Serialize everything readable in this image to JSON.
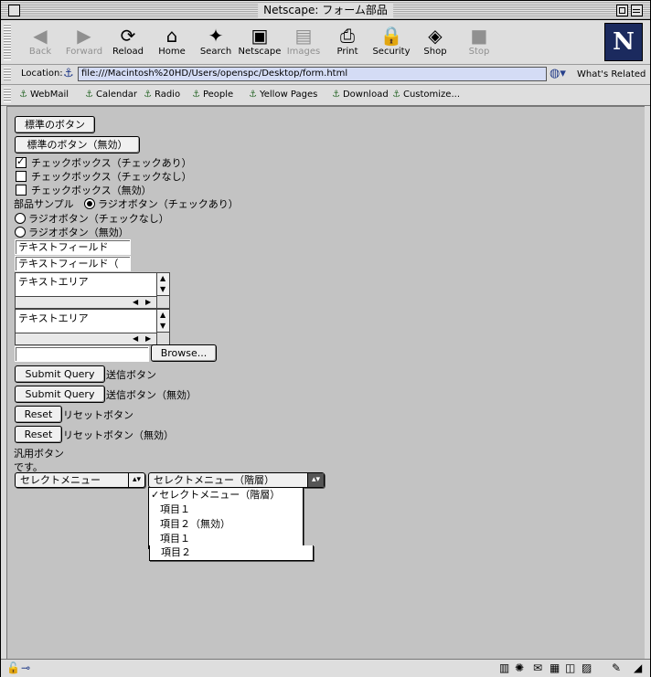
{
  "window": {
    "title": "Netscape: フォーム部品"
  },
  "toolbar": {
    "buttons": [
      {
        "label": "Back",
        "icon": "left-arrow-icon",
        "glyph": "◀",
        "enabled": false
      },
      {
        "label": "Forward",
        "icon": "right-arrow-icon",
        "glyph": "▶",
        "enabled": false
      },
      {
        "label": "Reload",
        "icon": "reload-icon",
        "glyph": "⟳",
        "enabled": true
      },
      {
        "label": "Home",
        "icon": "home-icon",
        "glyph": "⌂",
        "enabled": true
      },
      {
        "label": "Search",
        "icon": "search-icon",
        "glyph": "✦",
        "enabled": true
      },
      {
        "label": "Netscape",
        "icon": "my-netscape-icon",
        "glyph": "▣",
        "enabled": true
      },
      {
        "label": "Images",
        "icon": "images-icon",
        "glyph": "▤",
        "enabled": false
      },
      {
        "label": "Print",
        "icon": "printer-icon",
        "glyph": "⎙",
        "enabled": true
      },
      {
        "label": "Security",
        "icon": "padlock-icon",
        "glyph": "🔒",
        "enabled": true
      },
      {
        "label": "Shop",
        "icon": "shopping-bag-icon",
        "glyph": "◈",
        "enabled": true
      },
      {
        "label": "Stop",
        "icon": "stop-icon",
        "glyph": "■",
        "enabled": false
      }
    ],
    "logo_letter": "N"
  },
  "location": {
    "label": "Location:",
    "url": "file:///Macintosh%20HD/Users/openspc/Desktop/form.html",
    "whats_related": "What's Related"
  },
  "personal_bar": {
    "items": [
      "WebMail",
      "Calendar",
      "Radio",
      "People",
      "Yellow Pages",
      "Download",
      "Customize..."
    ]
  },
  "form": {
    "button_normal": "標準のボタン",
    "button_disabled": "標準のボタン（無効）",
    "checkbox_checked": "チェックボックス（チェックあり）",
    "checkbox_unchecked": "チェックボックス（チェックなし）",
    "checkbox_disabled": "チェックボックス（無効）",
    "parts_sample": "部品サンプル",
    "radio_checked": "ラジオボタン（チェックあり）",
    "radio_unchecked": "ラジオボタン（チェックなし）",
    "radio_disabled": "ラジオボタン（無効）",
    "textfield_value": "テキストフィールド",
    "textfield_disabled_value": "テキストフィールド（",
    "textarea_value": "テキストエリア",
    "textarea_disabled_value": "テキストエリア",
    "file_value": "",
    "browse_label": "Browse...",
    "submit_label": "Submit Query",
    "submit_caption": "送信ボタン",
    "submit_disabled_caption": "送信ボタン（無効）",
    "reset_label": "Reset",
    "reset_caption": "リセットボタン",
    "reset_disabled_caption": "リセットボタン（無効）",
    "generic_line1": "汎用ボタン",
    "generic_line2": "です。",
    "select_value": "セレクトメニュー",
    "select_hier_value": "セレクトメニュー（階層）",
    "menu_items": [
      "セレクトメニュー（階層）",
      "項目１",
      "項目２（無効）",
      "項目１",
      "項目２"
    ]
  }
}
